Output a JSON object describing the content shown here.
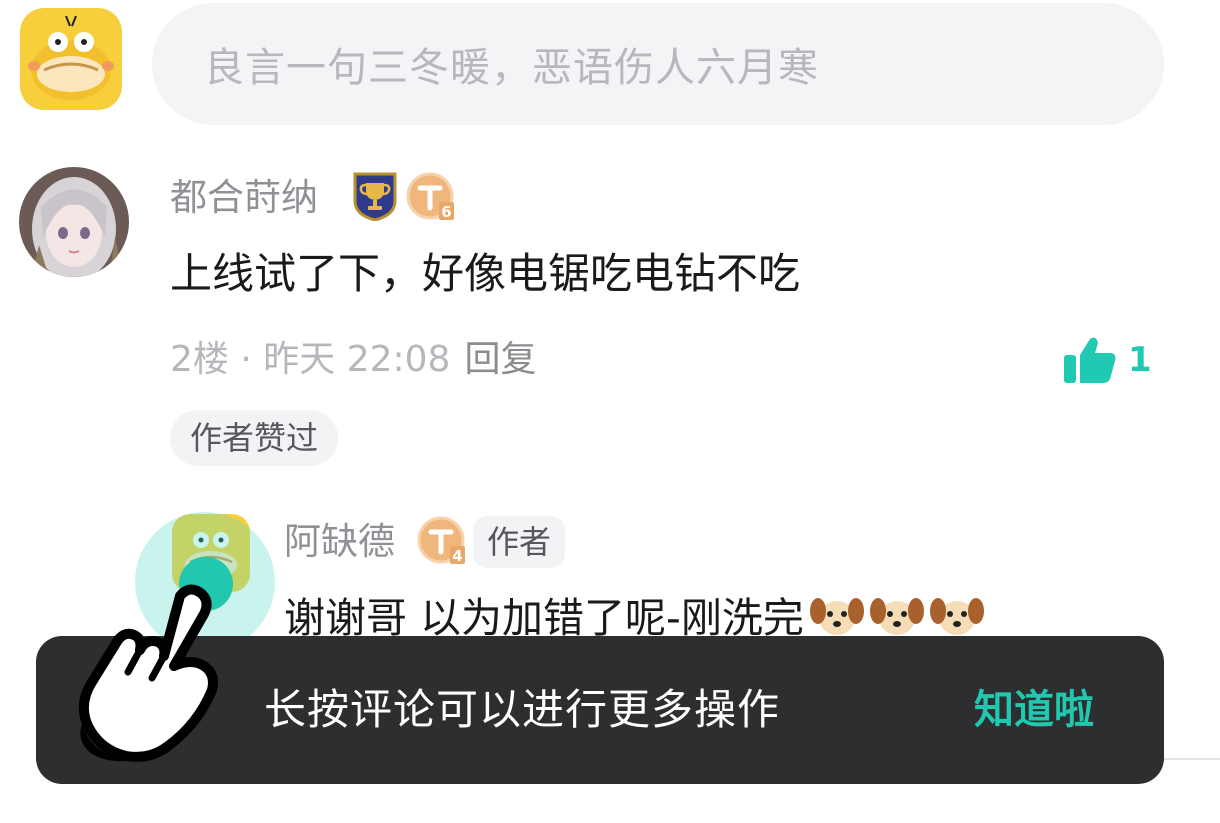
{
  "composer": {
    "placeholder": "良言一句三冬暖，恶语伤人六月寒",
    "avatar_icon": "psyduck-avatar-icon"
  },
  "comment": {
    "author": "都合莳纳",
    "badges": [
      "trophy-badge-icon",
      "level-badge-icon"
    ],
    "level": "T6",
    "text": "上线试了下，好像电锯吃电钻不吃",
    "floor": "2楼",
    "separator": " · ",
    "time": "昨天 22:08",
    "reply_label": "回复",
    "like_count": "1",
    "liked_tag": "作者赞过"
  },
  "reply": {
    "author": "阿缺德",
    "level": "T4",
    "author_tag": "作者",
    "text": "谢谢哥 以为加错了呢-刚洗完",
    "emoji_count": 3,
    "emoji_icon": "dog-emoji-icon"
  },
  "hint": {
    "message": "长按评论可以进行更多操作",
    "dismiss": "知道啦"
  },
  "colors": {
    "accent": "#22c7b0",
    "toast_bg": "#2d2e30",
    "placeholder": "#b6b8bd",
    "secondary_text": "#8f9196",
    "level_badge": "#e8a86a"
  }
}
